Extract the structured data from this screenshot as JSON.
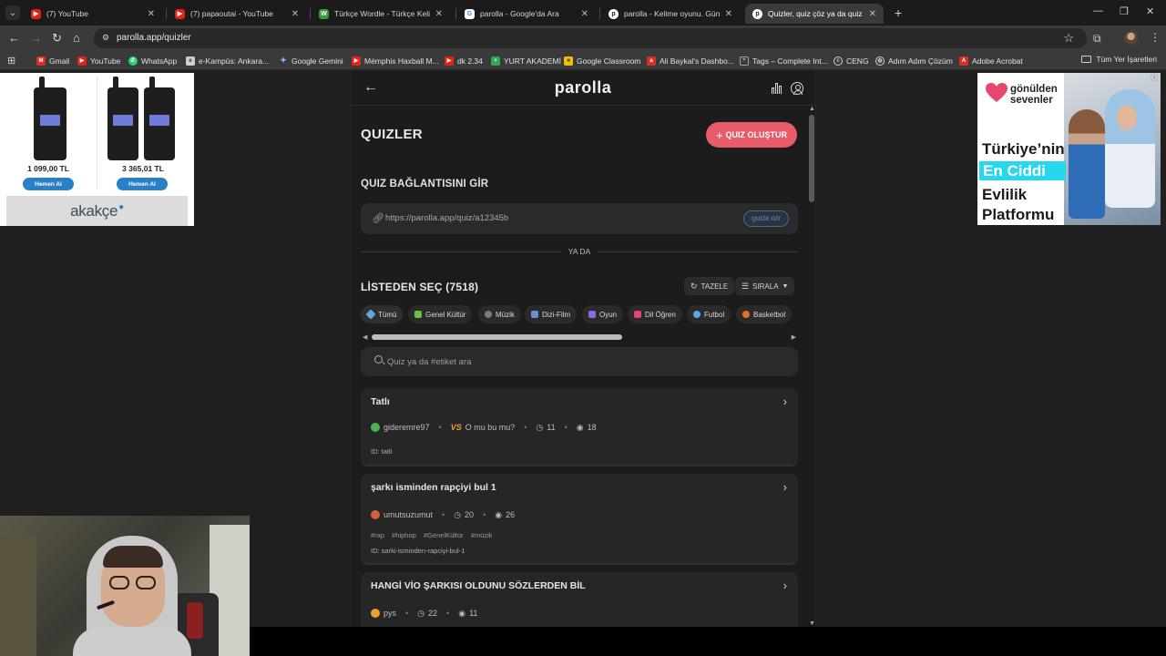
{
  "browser": {
    "tabs": [
      {
        "title": "(7) YouTube",
        "favicon": "youtube-icon",
        "color": "#e62117",
        "active": false
      },
      {
        "title": "(7) papaoutai - YouTube",
        "favicon": "youtube-icon",
        "color": "#e62117",
        "active": false
      },
      {
        "title": "Türkçe Wordle - Türkçe Kelime",
        "favicon": "wordle-icon",
        "color": "#3a9a3a",
        "active": false
      },
      {
        "title": "parolla - Google'da Ara",
        "favicon": "google-icon",
        "color": "#ffffff",
        "active": false
      },
      {
        "title": "parolla - Kelime oyunu. Günlük",
        "favicon": "parolla-icon",
        "color": "#ffffff",
        "active": false
      },
      {
        "title": "Quizler, quiz çöz ya da quiz olu",
        "favicon": "parolla-icon",
        "color": "#ffffff",
        "active": true
      }
    ],
    "url": "parolla.app/quizler",
    "bookmarks": [
      {
        "label": "Gmail",
        "icon": "gmail-icon",
        "color": "#d93025"
      },
      {
        "label": "YouTube",
        "icon": "youtube-icon",
        "color": "#e62117"
      },
      {
        "label": "WhatsApp",
        "icon": "whatsapp-icon",
        "color": "#25d366"
      },
      {
        "label": "e-Kampüs: Ankara...",
        "icon": "ekampus-icon",
        "color": "#cfcfcf"
      },
      {
        "label": "Google Gemini",
        "icon": "gemini-icon",
        "color": "#8ab4f8"
      },
      {
        "label": "Mémphis Haxball M...",
        "icon": "youtube-icon",
        "color": "#e62117"
      },
      {
        "label": "dk 2.34",
        "icon": "youtube-icon",
        "color": "#e62117"
      },
      {
        "label": "YURT AKADEMİ",
        "icon": "yurt-icon",
        "color": "#34a853"
      },
      {
        "label": "Google Classroom",
        "icon": "classroom-icon",
        "color": "#fbbc04"
      },
      {
        "label": "Ali Baykal's Dashbo...",
        "icon": "dashboard-icon",
        "color": "#d93025"
      },
      {
        "label": "Tags – Complete Int...",
        "icon": "tags-icon",
        "color": "#9aa0a6"
      },
      {
        "label": "CENG",
        "icon": "ceng-icon",
        "color": "#cfcfcf"
      },
      {
        "label": "Adım Adım Çözüm",
        "icon": "globe-icon",
        "color": "#cfcfcf"
      },
      {
        "label": "Adobe Acrobat",
        "icon": "acrobat-icon",
        "color": "#d93025"
      }
    ],
    "all_bookmarks": "Tüm Yer İşaretleri"
  },
  "ads": {
    "left": {
      "products": [
        {
          "price": "1 099,00 TL",
          "button": "Hemen Al"
        },
        {
          "price": "3 365,01 TL",
          "button": "Hemen Al"
        }
      ],
      "brand": "akakçe"
    },
    "right": {
      "brand_line1": "gönülden",
      "brand_line2": "sevenler",
      "line1": "Türkiye’nin",
      "highlight": "En Ciddi",
      "line3": "Evlilik",
      "line4": "Platformu"
    }
  },
  "app": {
    "logo": "parolla",
    "page_title": "QUIZLER",
    "create_button": "QUIZ OLUŞTUR",
    "link_section_title": "QUIZ BAĞLANTISINI GİR",
    "link_placeholder": "https://parolla.app/quiz/a12345b",
    "go_button": "QUIZE GİT",
    "or_text": "YA DA",
    "list_title": "LİSTEDEN SEÇ (7518)",
    "refresh_button": "TAZELE",
    "sort_button": "SIRALA",
    "categories": [
      {
        "label": "Tümü",
        "icon": "sparkle-icon",
        "color": "#5aa9e6"
      },
      {
        "label": "Genel Kültür",
        "icon": "books-icon",
        "color": "#6cc04a"
      },
      {
        "label": "Müzik",
        "icon": "music-icon",
        "color": "#7a7a7a"
      },
      {
        "label": "Dizi-Film",
        "icon": "tv-icon",
        "color": "#6a8fd8"
      },
      {
        "label": "Oyun",
        "icon": "gamepad-icon",
        "color": "#8a6ae0"
      },
      {
        "label": "Dil Öğren",
        "icon": "language-icon",
        "color": "#e0457a"
      },
      {
        "label": "Futbol",
        "icon": "football-icon",
        "color": "#5aa9e6"
      },
      {
        "label": "Basketbol",
        "icon": "basketball-icon",
        "color": "#e07030"
      }
    ],
    "search_placeholder": "Quiz ya da #etiket ara",
    "quizzes": [
      {
        "title": "Tatlı",
        "author": "gideremre97",
        "author_color": "#4caf50",
        "extra_label": "O mu bu mu?",
        "questions": "11",
        "views": "18",
        "tags": [],
        "id": "ID: tatli"
      },
      {
        "title": "şarkı isminden rapçiyi bul 1",
        "author": "umutsuzumut",
        "author_color": "#d2603a",
        "questions": "20",
        "views": "26",
        "tags": [
          "#rap",
          "#hiphop",
          "#GenelKültür",
          "#müzik"
        ],
        "id": "ID: sarki-isminden-rapciyi-bul-1"
      },
      {
        "title": "HANGİ VİO ŞARKISI OLDUNU SÖZLERDEN BİL",
        "author": "pys",
        "author_color": "#e8a030",
        "questions": "22",
        "views": "11",
        "tags": [],
        "id": ""
      }
    ]
  }
}
